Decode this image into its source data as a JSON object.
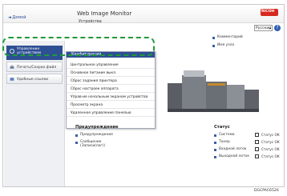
{
  "header": {
    "home_link": "◄ Домой",
    "app_title": "Web Image Monitor",
    "logo": "RICOH",
    "language": "Русский",
    "help_icon": "?"
  },
  "device_panel": {
    "label": "Устройства",
    "comment_label": "Комментарий",
    "host_label": "Имя узла"
  },
  "sidebar": {
    "items": [
      {
        "label": "Управление устройством",
        "icon": "gear-icon"
      },
      {
        "label": "Печать/Сохран.файл",
        "icon": "printer-icon"
      },
      {
        "label": "Удобные ссылки",
        "icon": "link-icon"
      }
    ]
  },
  "submenu": {
    "header": "Конфигурация",
    "items": [
      "Центральное управление",
      "Основное питание выкл.",
      "Сброс задания принтера",
      "Сброс настроек аппарата",
      "Управ-ие начальным экраном устройства",
      "Просмотр экрана",
      "Удаленное управление панелью"
    ]
  },
  "warnings": {
    "title": "Предупреждение",
    "items": [
      "Предупреждение",
      "Сообщение (Записи(лог))"
    ]
  },
  "status": {
    "title": "Статус",
    "rows": [
      {
        "label": "Система",
        "value": "Статус ОК"
      },
      {
        "label": "Тонер",
        "value": "Статус ОК"
      },
      {
        "label": "Входной лоток",
        "value": "Статус ОК"
      },
      {
        "label": "Выходной лоток",
        "value": "Статус ОК"
      }
    ]
  },
  "caption": "DGCPAC6526"
}
